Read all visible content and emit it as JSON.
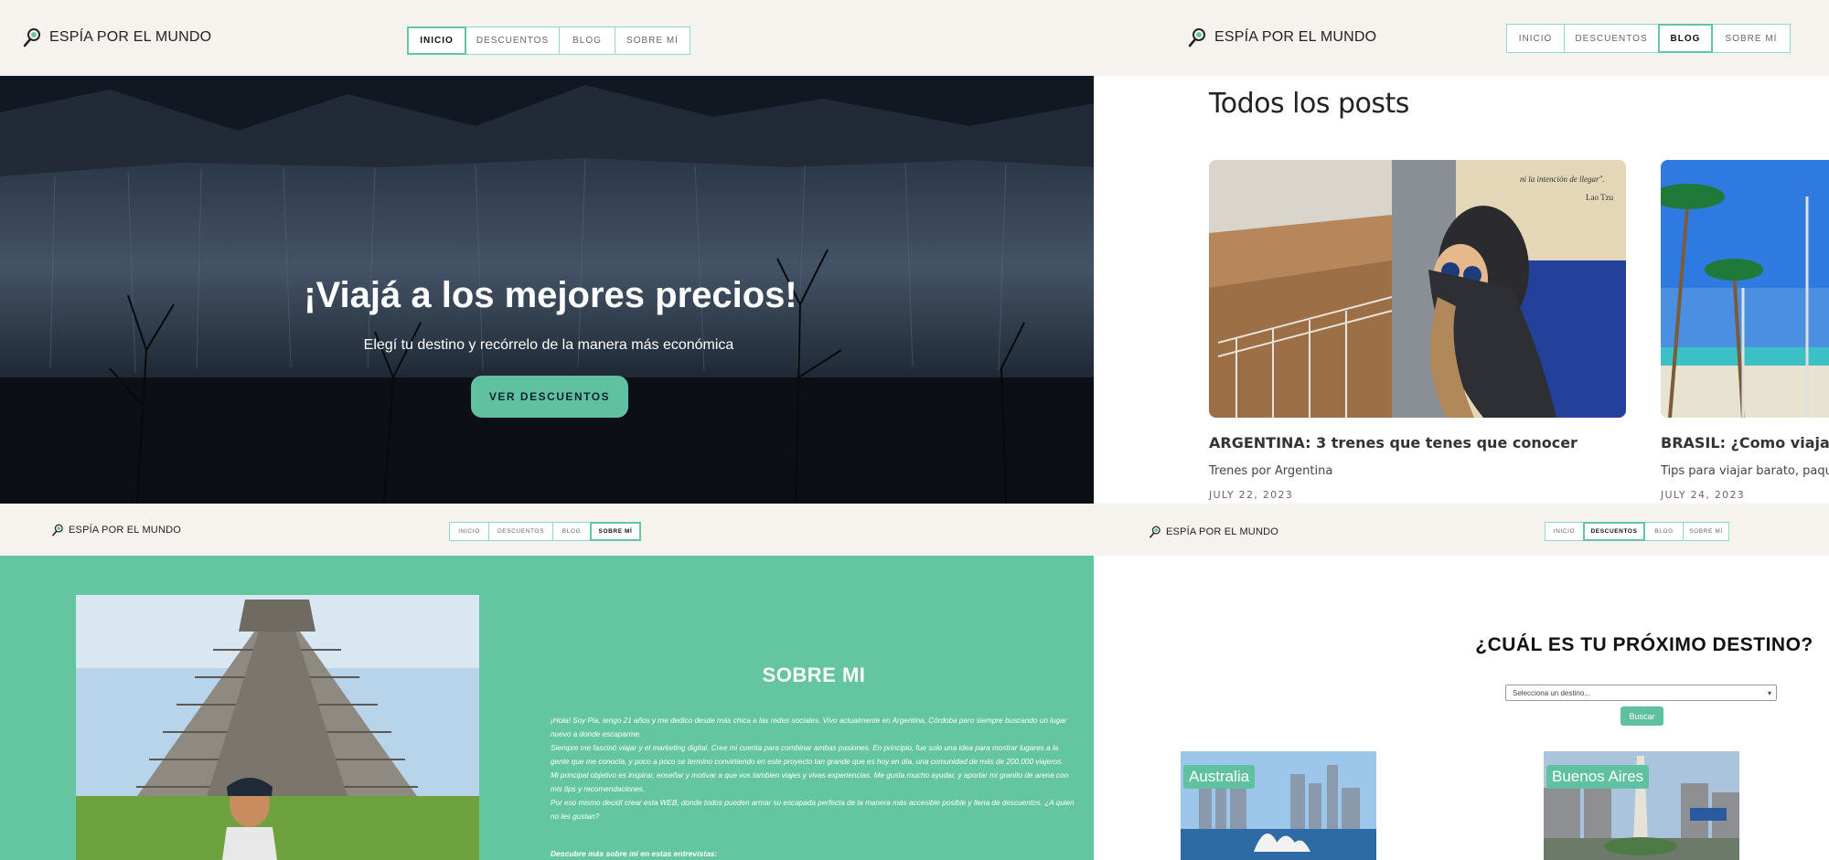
{
  "brand": {
    "name": "ESPÍA POR EL MUNDO"
  },
  "nav": {
    "items": [
      "INICIO",
      "DESCUENTOS",
      "BLOG",
      "SOBRE MÍ"
    ]
  },
  "home": {
    "title": "¡Viajá a los mejores precios!",
    "subtitle": "Elegí tu destino y recórrelo de la manera más económica",
    "cta_label": "VER DESCUENTOS"
  },
  "blog": {
    "heading": "Todos los posts",
    "posts": [
      {
        "title": "ARGENTINA: 3 trenes que tenes que conocer",
        "subtitle": "Trenes por Argentina",
        "date": "JULY 22, 2023",
        "image_text_1": "ni la intención de llegar\".",
        "image_text_2": "Lao Tzu"
      },
      {
        "title": "BRASIL: ¿Como viajar barato?",
        "subtitle": "Tips para viajar barato, paquetes",
        "date": "JULY 24, 2023"
      }
    ]
  },
  "about": {
    "heading": "SOBRE MI",
    "paragraphs": [
      "¡Hola! Soy Pia, tengo 21 años y me dedico desde más chica a las redes sociales. Vivo actualmente en Argentina, Córdoba pero siempre buscando un lugar nuevo a donde escaparme.",
      "Siempre me fascinó viajar y el marketing digital. Cree mi cuenta para combinar ambas pasiones. En principio, fue solo una idea para mostrar lugares a la gente que me conocía, y poco a poco se termino convirtiendo en este proyecto tan grande que es hoy en día, una comunidad de más de 200.000 viajeros.",
      "Mi principal objetivo es inspirar, enseñar y motivar a que vos tambien viajes y vivas experiencias. Me gusta mucho ayudar, y aportar mi granito de arena con mis tips y recomendaciones.",
      "Por eso mismo decidí crear esta WEB, donde todos pueden armar su escapada perfecta de la manera más accesible posible y llena de descuentos. ¿A quien no les gustan?"
    ],
    "more": "Descubre más sobre mi en estas entrevistas:"
  },
  "destinations": {
    "heading": "¿CUÁL ES TU PRÓXIMO DESTINO?",
    "select_placeholder": "Selecciona un destino...",
    "search_label": "Buscar",
    "cards": [
      "Australia",
      "Buenos Aires"
    ]
  },
  "active_tabs": {
    "panel1": "INICIO",
    "panel2": "BLOG",
    "panel3": "SOBRE MÍ",
    "panel4": "DESCUENTOS"
  },
  "colors": {
    "accent": "#63c5a2",
    "header_bg": "#f6f2ee",
    "about_bg": "#64c6a1"
  }
}
